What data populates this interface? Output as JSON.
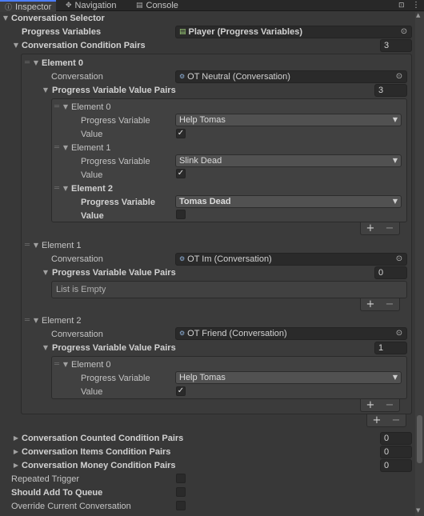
{
  "tabs": [
    {
      "label": "Inspector",
      "icon": "info-icon"
    },
    {
      "label": "Navigation",
      "icon": "navigation-icon"
    },
    {
      "label": "Console",
      "icon": "console-icon"
    }
  ],
  "component": {
    "title": "Conversation Selector"
  },
  "progress_variables": {
    "label": "Progress Variables",
    "value": "Player (Progress Variables)"
  },
  "conversation_condition_pairs": {
    "label": "Conversation Condition Pairs",
    "size": "3",
    "elements": [
      {
        "label": "Element 0",
        "conversation_label": "Conversation",
        "conversation_value": "OT Neutral (Conversation)",
        "pvvp_label": "Progress Variable Value Pairs",
        "pvvp_size": "3",
        "items": [
          {
            "label": "Element 0",
            "pv_label": "Progress Variable",
            "pv_value": "Help Tomas",
            "value_label": "Value",
            "checked": "✓"
          },
          {
            "label": "Element 1",
            "pv_label": "Progress Variable",
            "pv_value": "Slink Dead",
            "value_label": "Value",
            "checked": "✓"
          },
          {
            "label": "Element 2",
            "pv_label": "Progress Variable",
            "pv_value": "Tomas Dead",
            "value_label": "Value",
            "checked": ""
          }
        ]
      },
      {
        "label": "Element 1",
        "conversation_label": "Conversation",
        "conversation_value": "OT Im (Conversation)",
        "pvvp_label": "Progress Variable Value Pairs",
        "pvvp_size": "0",
        "empty_text": "List is Empty"
      },
      {
        "label": "Element 2",
        "conversation_label": "Conversation",
        "conversation_value": "OT Friend (Conversation)",
        "pvvp_label": "Progress Variable Value Pairs",
        "pvvp_size": "1",
        "items": [
          {
            "label": "Element 0",
            "pv_label": "Progress Variable",
            "pv_value": "Help Tomas",
            "value_label": "Value",
            "checked": "✓"
          }
        ]
      }
    ]
  },
  "list_buttons": {
    "add": "+",
    "remove": "−"
  },
  "other_lists": [
    {
      "label": "Conversation Counted Condition Pairs",
      "size": "0"
    },
    {
      "label": "Conversation Items Condition Pairs",
      "size": "0"
    },
    {
      "label": "Conversation Money Condition Pairs",
      "size": "0"
    }
  ],
  "toggles": [
    {
      "label": "Repeated Trigger"
    },
    {
      "label": "Should Add To Queue"
    },
    {
      "label": "Override Current Conversation"
    }
  ],
  "icons": {
    "foldout_open": "▼",
    "foldout_closed": "▶",
    "handle": "═",
    "picker": "⊙",
    "dropdown_arrow": "▼",
    "lock": "🔒",
    "menu": "⋮"
  },
  "colors": {
    "background": "#383838",
    "field": "#2a2a2a",
    "dropdown": "#515151",
    "tab_accent": "#4c7eff"
  }
}
